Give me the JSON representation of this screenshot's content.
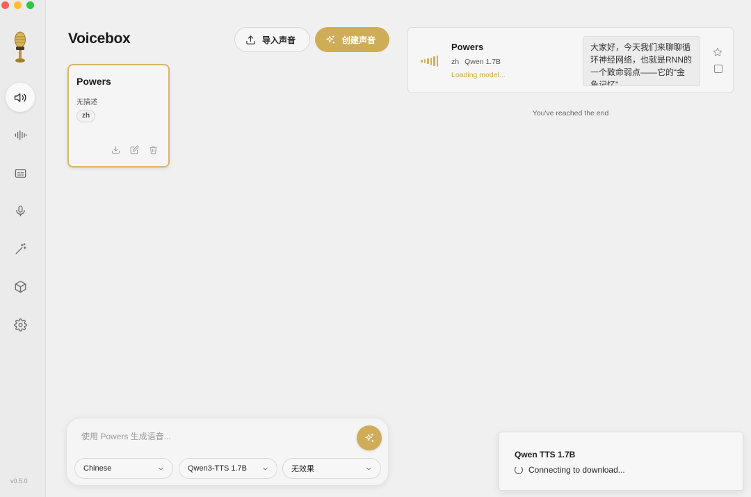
{
  "app": {
    "title": "Voicebox",
    "version": "v0.5.0"
  },
  "window_controls": [
    "close",
    "minimize",
    "maximize"
  ],
  "sidebar": {
    "items": [
      {
        "icon": "speaker-icon",
        "active": true
      },
      {
        "icon": "waveform-icon",
        "active": false
      },
      {
        "icon": "caption-icon",
        "active": false
      },
      {
        "icon": "microphone-icon",
        "active": false
      },
      {
        "icon": "magic-wand-icon",
        "active": false
      },
      {
        "icon": "box-icon",
        "active": false
      },
      {
        "icon": "gear-icon",
        "active": false
      }
    ]
  },
  "header": {
    "import_label": "导入声音",
    "create_label": "创建声音"
  },
  "voices": [
    {
      "name": "Powers",
      "description": "无描述",
      "language": "zh"
    }
  ],
  "history": {
    "items": [
      {
        "voice": "Powers",
        "language": "zh",
        "model": "Qwen 1.7B",
        "status": "Loading model...",
        "text": "大家好，今天我们来聊聊循环神经网络，也就是RNN的一个致命弱点——它的“金鱼记忆”"
      }
    ],
    "end_text": "You've reached the end"
  },
  "composer": {
    "placeholder": "使用 Powers 生成语音...",
    "language": "Chinese",
    "model": "Qwen3-TTS 1.7B",
    "effect": "无效果"
  },
  "toast": {
    "title": "Qwen TTS 1.7B",
    "message": "Connecting to download..."
  },
  "colors": {
    "accent": "#cfac58",
    "status": "#cfa94f",
    "background": "#f0f0f0"
  }
}
